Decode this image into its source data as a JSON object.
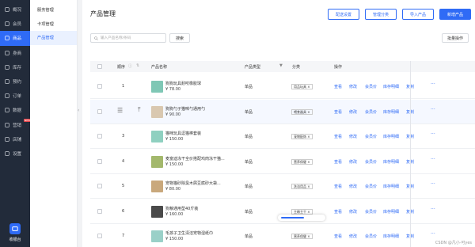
{
  "rail": {
    "items": [
      {
        "label": "概况",
        "icon": "overview-icon"
      },
      {
        "label": "会员",
        "icon": "member-icon"
      },
      {
        "label": "商品",
        "icon": "goods-icon",
        "active": true
      },
      {
        "label": "身商",
        "icon": "store-icon"
      },
      {
        "label": "库存",
        "icon": "stock-icon"
      },
      {
        "label": "预约",
        "icon": "booking-icon"
      },
      {
        "label": "订单",
        "icon": "order-icon"
      },
      {
        "label": "数据",
        "icon": "data-icon"
      },
      {
        "label": "营销",
        "icon": "marketing-icon",
        "badge": "NEW"
      },
      {
        "label": "店铺",
        "icon": "shop-icon"
      },
      {
        "label": "设置",
        "icon": "settings-icon"
      }
    ],
    "bottom_label": "收银台"
  },
  "side2": {
    "items": [
      "服务管理",
      "卡项管理",
      "产品管理"
    ]
  },
  "header": {
    "title": "产品管理",
    "buttons": [
      "配送设置",
      "管理分类",
      "导入产品",
      "新增产品"
    ]
  },
  "search": {
    "placeholder": "输入产品名称/条码",
    "button": "搜索"
  },
  "batch_button": "批量操作",
  "table": {
    "headers": [
      "顺序",
      "产品名称",
      "产品类型",
      "分类",
      "操作"
    ],
    "actions": [
      "查看",
      "修改",
      "会员价",
      "库存明细",
      "复制",
      "···"
    ],
    "rows": [
      {
        "idx": "1",
        "name": "狗狗玩具耐咬橡胶球",
        "price": "¥ 78.00",
        "type": "单品",
        "cat": "用品玩具 ×"
      },
      {
        "idx": "",
        "name": "狗狗勺子猫咪勺通用勺",
        "price": "¥ 90.00",
        "type": "单品",
        "cat": "喂食器具 ×"
      },
      {
        "idx": "3",
        "name": "猫咪玩具逗猫棒套装",
        "price": "¥ 150.00",
        "type": "单品",
        "cat": "宠物配饰 ×"
      },
      {
        "idx": "4",
        "name": "麦富迪冻干全价搭配鸡肉冻干猫...",
        "price": "¥ 150.00",
        "type": "单品",
        "cat": "营养保健 ×"
      },
      {
        "idx": "5",
        "name": "宠物猫砂除臭木屑豆腐砂大袋...",
        "price": "¥ 80.00",
        "type": "单品",
        "cat": "洗浴用品 ×"
      },
      {
        "idx": "6",
        "name": "狗粮通用型40斤装",
        "price": "¥ 160.00",
        "type": "单品",
        "cat": "主粮主干 ×"
      },
      {
        "idx": "7",
        "name": "毛孩子卫生清洁宠物湿纸巾",
        "price": "¥ 150.00",
        "type": "单品",
        "cat": "营养保健 ×"
      }
    ]
  },
  "progress": {
    "value": 0.55
  },
  "watermark": "CSDN @凡小·可yes",
  "colors": {
    "accent": "#2f6bf6",
    "rail": "#222b3a"
  }
}
